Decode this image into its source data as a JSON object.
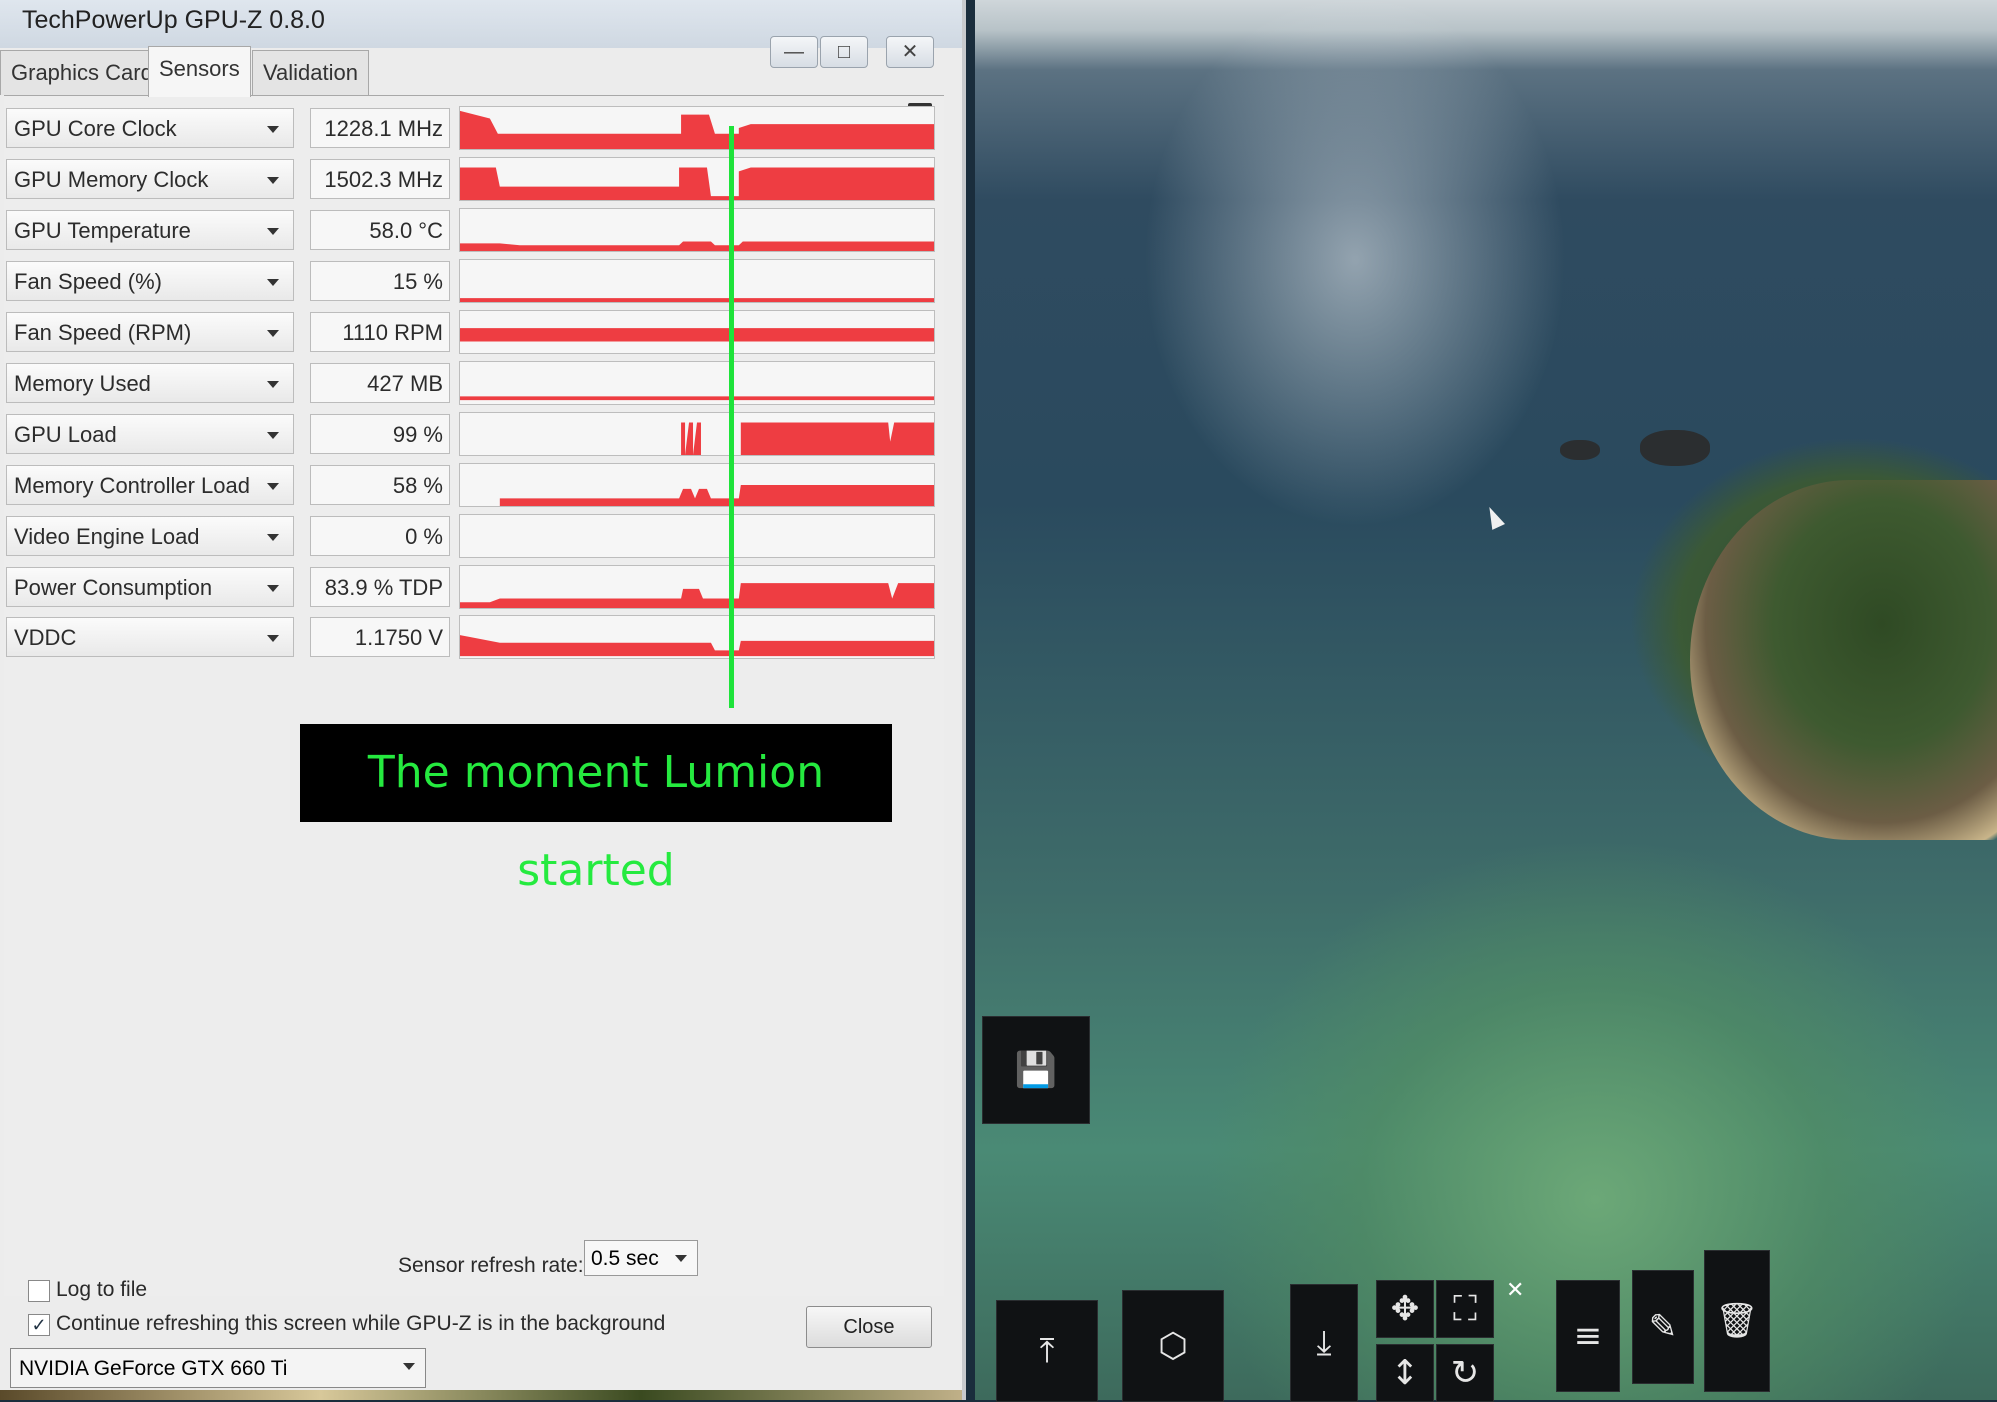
{
  "window": {
    "title": "TechPowerUp GPU-Z 0.8.0",
    "controls": [
      "—",
      "□",
      "✕"
    ]
  },
  "tabs": [
    {
      "label": "Graphics Card",
      "active": false
    },
    {
      "label": "Sensors",
      "active": true
    },
    {
      "label": "Validation",
      "active": false
    }
  ],
  "sensors": [
    {
      "name": "GPU Core Clock",
      "value": "1228.1 MHz"
    },
    {
      "name": "GPU Memory Clock",
      "value": "1502.3 MHz"
    },
    {
      "name": "GPU Temperature",
      "value": "58.0 °C"
    },
    {
      "name": "Fan Speed (%)",
      "value": "15 %"
    },
    {
      "name": "Fan Speed (RPM)",
      "value": "1110 RPM"
    },
    {
      "name": "Memory Used",
      "value": "427 MB"
    },
    {
      "name": "GPU Load",
      "value": "99 %"
    },
    {
      "name": "Memory Controller Load",
      "value": "58 %"
    },
    {
      "name": "Video Engine Load",
      "value": "0 %"
    },
    {
      "name": "Power Consumption",
      "value": "83.9 % TDP"
    },
    {
      "name": "VDDC",
      "value": "1.1750 V"
    }
  ],
  "graph_color": "#ee3d42",
  "annotation": {
    "text": "The moment Lumion started",
    "text_color": "#25ea3f",
    "line_color": "#1ee33a"
  },
  "footer": {
    "log_label": "Log to file",
    "log_checked": false,
    "continue_label": "Continue refreshing this screen while GPU-Z is in the background",
    "continue_checked": true,
    "refresh_label": "Sensor refresh rate:",
    "refresh_value": "0.5 sec",
    "close_label": "Close",
    "gpu_select_value": "NVIDIA GeForce GTX 660 Ti"
  },
  "lumion_toolbar": {
    "icons": [
      "save-icon",
      "import-icon",
      "box-icon",
      "download-icon",
      "move-icon",
      "scale-icon",
      "height-icon",
      "rotate-icon",
      "menu-icon",
      "edit-icon",
      "trash-icon"
    ]
  }
}
